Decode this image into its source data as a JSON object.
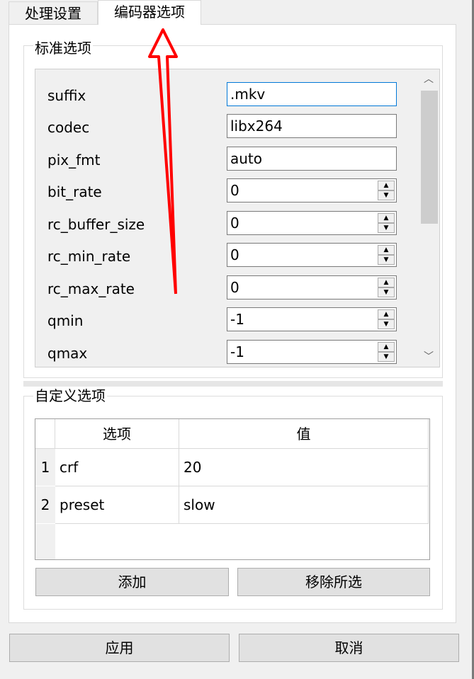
{
  "tabs": [
    {
      "label": "处理设置"
    },
    {
      "label": "编码器选项"
    }
  ],
  "standard_group": {
    "title": "标准选项",
    "fields": [
      {
        "label": "suffix",
        "value": ".mkv"
      },
      {
        "label": "codec",
        "value": "libx264"
      },
      {
        "label": "pix_fmt",
        "value": "auto"
      },
      {
        "label": "bit_rate",
        "value": "0"
      },
      {
        "label": "rc_buffer_size",
        "value": "0"
      },
      {
        "label": "rc_min_rate",
        "value": "0"
      },
      {
        "label": "rc_max_rate",
        "value": "0"
      },
      {
        "label": "qmin",
        "value": "-1"
      },
      {
        "label": "qmax",
        "value": "-1"
      }
    ]
  },
  "custom_group": {
    "title": "自定义选项",
    "columns": [
      "选项",
      "值"
    ],
    "rows": [
      {
        "index": "1",
        "option": "crf",
        "value": "20"
      },
      {
        "index": "2",
        "option": "preset",
        "value": "slow"
      }
    ],
    "add_label": "添加",
    "remove_label": "移除所选"
  },
  "footer": {
    "apply_label": "应用",
    "cancel_label": "取消"
  },
  "colors": {
    "accent": "#0078d7",
    "arrow": "#ff0000"
  }
}
